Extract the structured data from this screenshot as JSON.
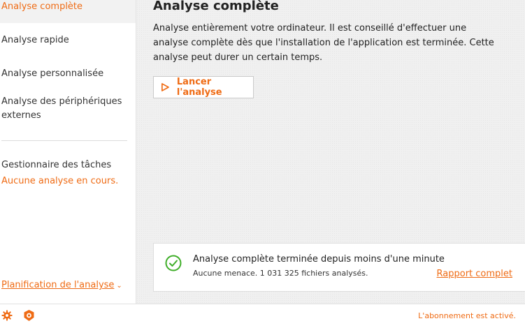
{
  "sidebar": {
    "items": [
      {
        "label": "Analyse complète",
        "active": true
      },
      {
        "label": "Analyse rapide",
        "active": false
      },
      {
        "label": "Analyse personnalisée",
        "active": false
      },
      {
        "label": "Analyse des périphériques externes",
        "active": false
      }
    ],
    "task_manager": {
      "title": "Gestionnaire des tâches",
      "status": "Aucune analyse en cours."
    },
    "schedule_label": "Planification de l'analyse"
  },
  "main": {
    "title": "Analyse complète",
    "description": "Analyse entièrement votre ordinateur. Il est conseillé d'effectuer une analyse complète dès que l'installation de l'application est terminée. Cette analyse peut durer un certain temps.",
    "launch_button": "Lancer l'analyse"
  },
  "result": {
    "title": "Analyse complète terminée depuis moins d'une minute",
    "subtitle": "Aucune menace. 1 031 325 fichiers analysés.",
    "report_link": "Rapport complet"
  },
  "footer": {
    "subscription_status": "L'abonnement est activé."
  },
  "colors": {
    "accent": "#ef6b14",
    "success": "#3fae29"
  },
  "icons": [
    "play-icon",
    "check-circle-icon",
    "gear-icon",
    "brand-logo-icon",
    "chevron-down-icon"
  ]
}
